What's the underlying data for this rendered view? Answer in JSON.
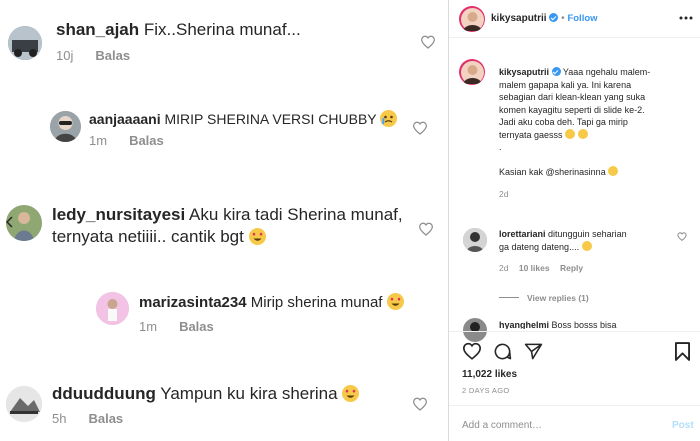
{
  "comments": [
    {
      "user": "shan_ajah",
      "text": "Fix..Sherina munaf...",
      "time": "10j",
      "reply": "Balas"
    },
    {
      "user": "aanjaaaani",
      "text": "MIRIP SHERINA VERSI CHUBBY",
      "time": "1m",
      "reply": "Balas"
    },
    {
      "user": "ledy_nursitayesi",
      "text_line1": "Aku kira tadi Sherina munaf,",
      "text_line2": "ternyata netiiii.. cantik bgt",
      "time": "",
      "reply": ""
    },
    {
      "user": "marizasinta234",
      "text": "Mirip sherina munaf",
      "time": "1m",
      "reply": "Balas"
    },
    {
      "user": "dduudduung",
      "text": "Yampun ku kira sherina",
      "time": "5h",
      "reply": "Balas"
    }
  ],
  "post": {
    "author": "kikysaputrii",
    "follow_sep": "•",
    "follow_label": "Follow",
    "caption_user": "kikysaputrii",
    "caption_line1": "Yaaa ngehalu malem-",
    "caption_line2": "malem gapapa kali ya. Ini karena",
    "caption_line3": "sebagian dari klean-klean yang suka",
    "caption_line4": "komen kayagitu seperti di slide ke-2.",
    "caption_line5": "Jadi aku coba deh. Tapi ga mirip",
    "caption_line6": "ternyata gaesss",
    "caption_dot": ".",
    "caption_line7": "Kasian kak @sherinasinna",
    "caption_time": "2d",
    "comment1_user": "lorettariani",
    "comment1_line1": "ditungguin seharian",
    "comment1_line2": "ga dateng dateng....",
    "comment1_time": "2d",
    "comment1_likes": "10 likes",
    "comment1_reply": "Reply",
    "view_replies": "View replies (1)",
    "comment2_user": "hyanghelmi",
    "comment2_text": "Boss bosss bisa",
    "likes": "11,022 likes",
    "date": "2 DAYS AGO",
    "add_comment_placeholder": "Add a comment…",
    "post_label": "Post"
  },
  "colors": {
    "accent": "#3897f0",
    "text": "#262626",
    "muted": "#8e8e8e",
    "border": "#dbdbdb"
  }
}
